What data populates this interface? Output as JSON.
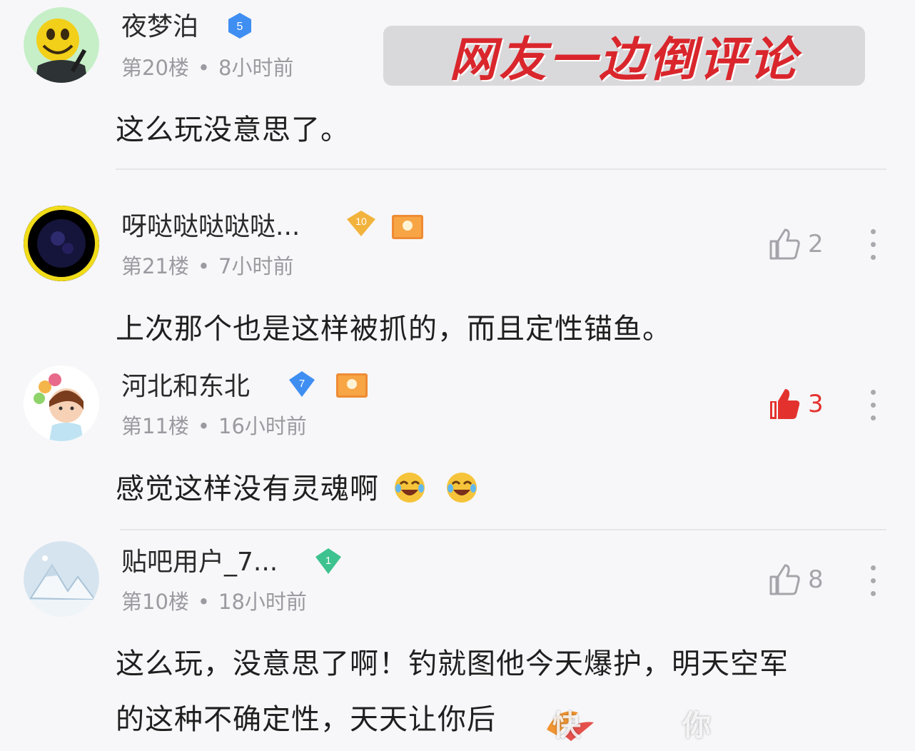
{
  "banner": {
    "title": "网友一边倒评论"
  },
  "comments": [
    {
      "username": "夜梦泊",
      "level": "5",
      "floor": "第20楼",
      "time": "8小时前",
      "text": "这么玩没意思了。"
    },
    {
      "username": "呀哒哒哒哒哒...",
      "level": "10",
      "floor": "第21楼",
      "time": "7小时前",
      "likes": "2",
      "text": "上次那个也是这样被抓的，而且定性锚鱼。"
    },
    {
      "username": "河北和东北",
      "level": "7",
      "floor": "第11楼",
      "time": "16小时前",
      "likes": "3",
      "text": "感觉这样没有灵魂啊"
    },
    {
      "username": "贴吧用户_7...",
      "level": "1",
      "floor": "第10楼",
      "time": "18小时前",
      "likes": "8",
      "text_line1": "这么玩，没意思了啊！钓就图他今天爆护，明天空军",
      "text_line2": "的这种不确定性，天天让你后"
    }
  ],
  "watermark": {
    "left": "快",
    "right": "你"
  },
  "colors": {
    "accent_red": "#e3322e",
    "level_blue": "#3f8ef2",
    "level_gold": "#f2b33d",
    "level_green": "#3ec28f"
  }
}
